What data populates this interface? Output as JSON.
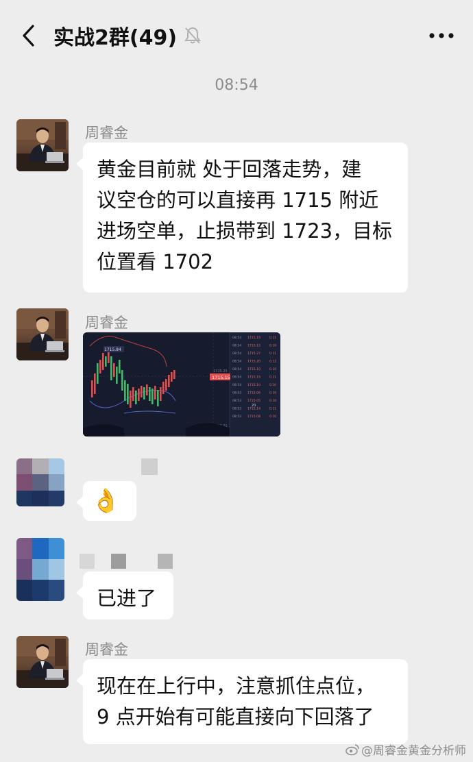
{
  "header": {
    "title": "实战2群(49)",
    "back_icon": "chevron-left-icon",
    "mute_icon": "bell-off-icon",
    "more_icon": "more-dots-icon"
  },
  "timestamp": "08:54",
  "messages": [
    {
      "sender": "周睿金",
      "lines": [
        "黄金目前就  处于回落走势，建",
        "议空仓的可以直接再 1715 附近",
        "进场空单，止损带到 1723，目标",
        "位置看 1702"
      ]
    },
    {
      "sender": "周睿金",
      "chart": {
        "price_label": "1715.84",
        "current_price": "1715.15",
        "mid_label": "1715.25",
        "low_label": "1713.01",
        "mid_value": "20",
        "mid_value2": "0.01",
        "order_rows": [
          [
            "08:54",
            "1715.15",
            "0.11"
          ],
          [
            "08:54",
            "1715.15",
            "0.10"
          ],
          [
            "08:54",
            "1715.27",
            "0.11"
          ],
          [
            "08:54",
            "1715.20",
            "0.12"
          ],
          [
            "08:54",
            "1715.10",
            "0.10"
          ],
          [
            "08:54",
            "1715.15",
            "0.11"
          ],
          [
            "08:54",
            "1715.10",
            "0.10"
          ],
          [
            "08:53",
            "1715.06",
            "0.10"
          ],
          [
            "08:53",
            "1715.05",
            "0.10"
          ],
          [
            "08:53",
            "1715.14",
            "0.11"
          ],
          [
            "08:53",
            "1715.08",
            "0.10"
          ]
        ]
      }
    },
    {
      "sender_blurred": true,
      "emoji": "👌"
    },
    {
      "sender_blurred": true,
      "text": "已进了"
    },
    {
      "sender": "周睿金",
      "lines": [
        "现在在上行中，注意抓住点位，",
        "9 点开始有可能直接向下回落了"
      ]
    }
  ],
  "watermark": "@周睿金黄金分析师",
  "colors": {
    "background": "#ededed",
    "bubble": "#ffffff",
    "chart_bg": "#161b2e",
    "candle_up": "#e84d4d",
    "candle_down": "#3dbd6a"
  }
}
